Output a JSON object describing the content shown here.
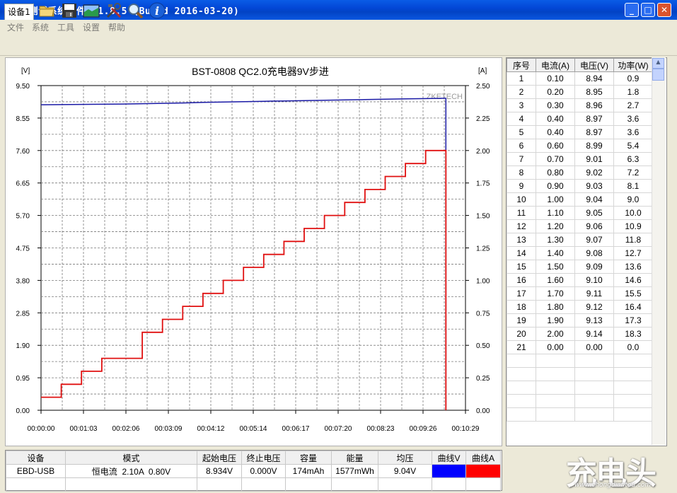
{
  "window": {
    "title": "EB测试系统软件 V1.8.5 (Build 2016-03-20)",
    "min_glyph": "_",
    "max_glyph": "□",
    "close_glyph": "✕"
  },
  "menu": [
    "文件",
    "系统",
    "工具",
    "设置",
    "帮助"
  ],
  "toolbar": {
    "device_tab": "设备1",
    "icons": [
      "folder-icon",
      "save-icon",
      "chart-icon",
      "tools-icon",
      "zoom-icon",
      "info-icon"
    ]
  },
  "chart_data": {
    "type": "line",
    "title": "BST-0808 QC2.0充电器9V步进",
    "watermark": "ZKETECH",
    "left_axis_unit": "[V]",
    "right_axis_unit": "[A]",
    "x_tick_labels": [
      "00:00:00",
      "00:01:03",
      "00:02:06",
      "00:03:09",
      "00:04:12",
      "00:05:14",
      "00:06:17",
      "00:07:20",
      "00:08:23",
      "00:09:26",
      "00:10:29"
    ],
    "x_range_seconds": [
      0,
      629
    ],
    "y_left_ticks": [
      "9.50",
      "8.55",
      "7.60",
      "6.65",
      "5.70",
      "4.75",
      "3.80",
      "2.85",
      "1.90",
      "0.95",
      "0.00"
    ],
    "y_left_range": [
      0,
      9.5
    ],
    "y_right_ticks": [
      "2.50",
      "2.25",
      "2.00",
      "1.75",
      "1.50",
      "1.25",
      "1.00",
      "0.75",
      "0.50",
      "0.25",
      "0.00"
    ],
    "y_right_range": [
      0,
      2.5
    ],
    "grid": true,
    "series": [
      {
        "axis": "left",
        "color": "#1a1aa6",
        "points": [
          [
            0,
            8.94
          ],
          [
            60,
            8.95
          ],
          [
            120,
            8.96
          ],
          [
            150,
            8.97
          ],
          [
            180,
            8.98
          ],
          [
            210,
            8.99
          ],
          [
            240,
            9.01
          ],
          [
            270,
            9.02
          ],
          [
            300,
            9.03
          ],
          [
            330,
            9.04
          ],
          [
            360,
            9.05
          ],
          [
            390,
            9.06
          ],
          [
            420,
            9.07
          ],
          [
            450,
            9.08
          ],
          [
            480,
            9.09
          ],
          [
            510,
            9.1
          ],
          [
            540,
            9.11
          ],
          [
            570,
            9.12
          ],
          [
            600,
            9.13
          ],
          [
            600,
            9.14
          ],
          [
            600,
            0.0
          ]
        ]
      },
      {
        "axis": "right",
        "color": "#e01010",
        "steps": [
          [
            0,
            0.1
          ],
          [
            30,
            0.2
          ],
          [
            60,
            0.3
          ],
          [
            90,
            0.4
          ],
          [
            150,
            0.6
          ],
          [
            180,
            0.7
          ],
          [
            210,
            0.8
          ],
          [
            240,
            0.9
          ],
          [
            270,
            1.0
          ],
          [
            300,
            1.1
          ],
          [
            330,
            1.2
          ],
          [
            360,
            1.3
          ],
          [
            390,
            1.4
          ],
          [
            420,
            1.5
          ],
          [
            450,
            1.6
          ],
          [
            480,
            1.7
          ],
          [
            510,
            1.8
          ],
          [
            540,
            1.9
          ],
          [
            570,
            2.0
          ],
          [
            600,
            0.0
          ]
        ]
      }
    ]
  },
  "table": {
    "headers": [
      "序号",
      "电流(A)",
      "电压(V)",
      "功率(W)"
    ],
    "rows": [
      [
        "1",
        "0.10",
        "8.94",
        "0.9"
      ],
      [
        "2",
        "0.20",
        "8.95",
        "1.8"
      ],
      [
        "3",
        "0.30",
        "8.96",
        "2.7"
      ],
      [
        "4",
        "0.40",
        "8.97",
        "3.6"
      ],
      [
        "5",
        "0.40",
        "8.97",
        "3.6"
      ],
      [
        "6",
        "0.60",
        "8.99",
        "5.4"
      ],
      [
        "7",
        "0.70",
        "9.01",
        "6.3"
      ],
      [
        "8",
        "0.80",
        "9.02",
        "7.2"
      ],
      [
        "9",
        "0.90",
        "9.03",
        "8.1"
      ],
      [
        "10",
        "1.00",
        "9.04",
        "9.0"
      ],
      [
        "11",
        "1.10",
        "9.05",
        "10.0"
      ],
      [
        "12",
        "1.20",
        "9.06",
        "10.9"
      ],
      [
        "13",
        "1.30",
        "9.07",
        "11.8"
      ],
      [
        "14",
        "1.40",
        "9.08",
        "12.7"
      ],
      [
        "15",
        "1.50",
        "9.09",
        "13.6"
      ],
      [
        "16",
        "1.60",
        "9.10",
        "14.6"
      ],
      [
        "17",
        "1.70",
        "9.11",
        "15.5"
      ],
      [
        "18",
        "1.80",
        "9.12",
        "16.4"
      ],
      [
        "19",
        "1.90",
        "9.13",
        "17.3"
      ],
      [
        "20",
        "2.00",
        "9.14",
        "18.3"
      ],
      [
        "21",
        "0.00",
        "0.00",
        "0.0"
      ]
    ],
    "empty_rows": 5
  },
  "status": {
    "headers": [
      "设备",
      "模式",
      "起始电压",
      "终止电压",
      "容量",
      "能量",
      "均压",
      "曲线V",
      "曲线A"
    ],
    "values": [
      "EBD-USB",
      "恒电流  2.10A  0.80V",
      "8.934V",
      "0.000V",
      "174mAh",
      "1577mWh",
      "9.04V"
    ],
    "curve_v_color": "#0000ff",
    "curve_a_color": "#ff0000"
  },
  "watermark": {
    "logo": "充电头",
    "url": "www.chongdiantou.com"
  }
}
